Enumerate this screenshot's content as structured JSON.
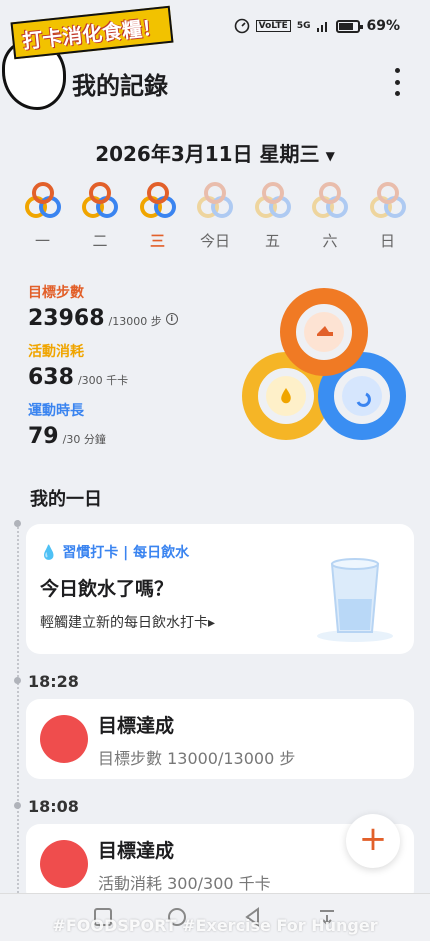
{
  "status": {
    "battery": "69%",
    "network": "5G",
    "volte": "VoLTE"
  },
  "sticker": {
    "text": "打卡消化食糧！"
  },
  "header": {
    "title": "我的記錄"
  },
  "date": {
    "label": "2026年3月11日 星期三",
    "caret": "▼"
  },
  "week": [
    {
      "label": "一",
      "active": false,
      "faded": false
    },
    {
      "label": "二",
      "active": false,
      "faded": false
    },
    {
      "label": "三",
      "active": true,
      "faded": false
    },
    {
      "label": "今日",
      "active": false,
      "faded": true
    },
    {
      "label": "五",
      "active": false,
      "faded": true
    },
    {
      "label": "六",
      "active": false,
      "faded": true
    },
    {
      "label": "日",
      "active": false,
      "faded": true
    }
  ],
  "stats": {
    "steps": {
      "label": "目標步數",
      "value": "23968",
      "goal": "/13000 步"
    },
    "calories": {
      "label": "活動消耗",
      "value": "638",
      "goal": "/300 千卡"
    },
    "duration": {
      "label": "運動時長",
      "value": "79",
      "goal": "/30 分鐘"
    }
  },
  "colors": {
    "steps": "#e2602a",
    "calories": "#f0a500",
    "duration": "#3a84f0",
    "goal_icon": "#ef4d4d"
  },
  "section": {
    "title": "我的一日"
  },
  "water": {
    "tag": "習慣打卡 | 每日飲水",
    "title": "今日飲水了嗎？",
    "subtitle": "輕觸建立新的每日飲水打卡",
    "arrow": "▸"
  },
  "timeline": [
    {
      "time": "18:28",
      "title": "目標達成",
      "subtitle": "目標步數 13000/13000 步",
      "icon": "shoe-icon"
    },
    {
      "time": "18:08",
      "title": "目標達成",
      "subtitle": "活動消耗 300/300 千卡",
      "icon": "flame-icon"
    }
  ],
  "fab": {
    "label": "+"
  },
  "watermark": "#FOODSPORT #Exercise For Hunger"
}
